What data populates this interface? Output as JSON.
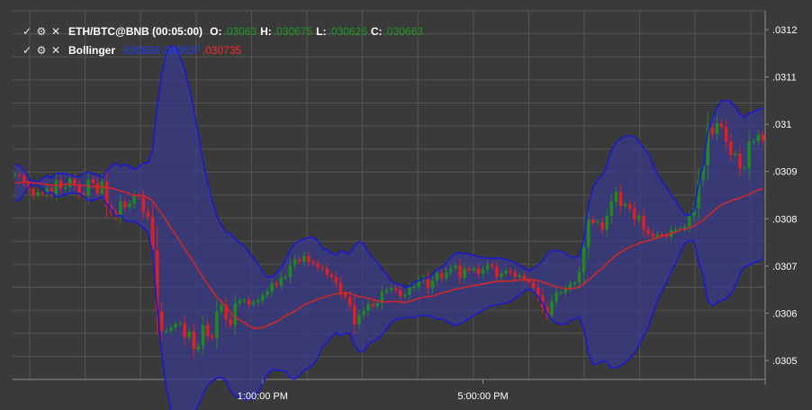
{
  "legend": {
    "symbol": "ETH/BTC@BNB (00:05:00)",
    "o_label": "O:",
    "o_value": ".03063",
    "h_label": "H:",
    "h_value": ".030675",
    "l_label": "L:",
    "l_value": ".030626",
    "c_label": "C:",
    "c_value": ".030663",
    "indicator": "Bollinger",
    "bb_upper": ".030838",
    "bb_lower": ".030637",
    "bb_middle": ".030735"
  },
  "icons": [
    "check-icon",
    "gear-icon",
    "close-icon"
  ],
  "colors": {
    "background": "#3a3a3a",
    "grid": "#555555",
    "up_candle": "#1f8a1f",
    "down_candle": "#e02020",
    "bollinger_band": "#1a1ad0",
    "bollinger_fill": "#3a3a8a",
    "bollinger_middle": "#d02828"
  },
  "chart_data": {
    "type": "candlestick",
    "ylim": [
      0.03046,
      0.03124
    ],
    "y_ticks": [
      ".0312",
      ".0311",
      ".031",
      ".0309",
      ".0308",
      ".0307",
      ".0306",
      ".0305"
    ],
    "y_tick_values": [
      0.0312,
      0.0311,
      0.031,
      0.0309,
      0.0308,
      0.0307,
      0.0306,
      0.0305
    ],
    "x_ticks": [
      {
        "label": "1:00:00 PM",
        "index": 54
      },
      {
        "label": "5:00:00 PM",
        "index": 102
      }
    ],
    "close": [
      0.030893,
      0.030891,
      0.030876,
      0.030864,
      0.03085,
      0.030856,
      0.030853,
      0.030865,
      0.030853,
      0.030881,
      0.030864,
      0.030867,
      0.030885,
      0.030871,
      0.030853,
      0.030849,
      0.030883,
      0.030875,
      0.030853,
      0.030879,
      0.030826,
      0.030814,
      0.030805,
      0.030836,
      0.030824,
      0.030832,
      0.030849,
      0.030846,
      0.030815,
      0.030804,
      0.030734,
      0.030604,
      0.030563,
      0.030563,
      0.03057,
      0.030578,
      0.030579,
      0.030549,
      0.030561,
      0.030523,
      0.030531,
      0.030575,
      0.030552,
      0.030548,
      0.030604,
      0.030618,
      0.030587,
      0.030575,
      0.030621,
      0.030627,
      0.030628,
      0.030619,
      0.030623,
      0.030628,
      0.030638,
      0.030646,
      0.030663,
      0.030659,
      0.030675,
      0.030676,
      0.030702,
      0.030714,
      0.030709,
      0.030721,
      0.030708,
      0.030706,
      0.030697,
      0.030695,
      0.030682,
      0.030677,
      0.030664,
      0.030642,
      0.030635,
      0.030617,
      0.030576,
      0.030596,
      0.030605,
      0.03062,
      0.030615,
      0.030621,
      0.030645,
      0.030649,
      0.030653,
      0.030649,
      0.030636,
      0.030639,
      0.030654,
      0.030656,
      0.03067,
      0.030675,
      0.030653,
      0.030669,
      0.030685,
      0.030674,
      0.030687,
      0.030695,
      0.030701,
      0.030675,
      0.030695,
      0.030691,
      0.030695,
      0.030683,
      0.030692,
      0.030702,
      0.030698,
      0.030677,
      0.030684,
      0.03069,
      0.030686,
      0.030676,
      0.03068,
      0.030671,
      0.030666,
      0.030654,
      0.030637,
      0.030612,
      0.030596,
      0.030625,
      0.030644,
      0.030644,
      0.030653,
      0.030662,
      0.030665,
      0.030687,
      0.03074,
      0.030798,
      0.030791,
      0.030793,
      0.030777,
      0.030806,
      0.030836,
      0.030857,
      0.030827,
      0.030831,
      0.030822,
      0.030798,
      0.030806,
      0.030777,
      0.030768,
      0.030762,
      0.030767,
      0.030765,
      0.030762,
      0.030776,
      0.030777,
      0.030778,
      0.030784,
      0.030805,
      0.030823,
      0.030883,
      0.030913,
      0.030992,
      0.030979,
      0.031002,
      0.030994,
      0.030964,
      0.030935,
      0.030938,
      0.030906,
      0.030907,
      0.030962,
      0.030964,
      0.030978,
      0.030966
    ],
    "bollinger": {
      "upper": [
        0.030915,
        0.030912,
        0.030903,
        0.030887,
        0.030868,
        0.030878,
        0.030885,
        0.030891,
        0.030886,
        0.030896,
        0.030896,
        0.030895,
        0.030893,
        0.030889,
        0.030889,
        0.030896,
        0.030899,
        0.030895,
        0.030893,
        0.030887,
        0.030901,
        0.030911,
        0.030918,
        0.030911,
        0.030915,
        0.030911,
        0.030905,
        0.03091,
        0.030918,
        0.030919,
        0.030945,
        0.031036,
        0.031106,
        0.03115,
        0.031165,
        0.031162,
        0.031142,
        0.031114,
        0.031075,
        0.031028,
        0.030977,
        0.030922,
        0.030876,
        0.030839,
        0.030806,
        0.030786,
        0.030771,
        0.030768,
        0.030758,
        0.030748,
        0.030743,
        0.030728,
        0.030717,
        0.030704,
        0.030688,
        0.030677,
        0.030676,
        0.030685,
        0.030697,
        0.030713,
        0.030734,
        0.030747,
        0.030753,
        0.030757,
        0.03076,
        0.030761,
        0.030754,
        0.030737,
        0.030734,
        0.030728,
        0.030723,
        0.030732,
        0.030728,
        0.030726,
        0.030743,
        0.030751,
        0.030747,
        0.030729,
        0.030717,
        0.030707,
        0.030693,
        0.030682,
        0.030669,
        0.030662,
        0.030661,
        0.030655,
        0.030658,
        0.030666,
        0.030669,
        0.030673,
        0.030675,
        0.030682,
        0.030693,
        0.030697,
        0.030706,
        0.030718,
        0.030727,
        0.030728,
        0.030727,
        0.030725,
        0.030723,
        0.030719,
        0.030718,
        0.030717,
        0.030716,
        0.030717,
        0.030716,
        0.030714,
        0.030711,
        0.030707,
        0.030701,
        0.030695,
        0.030691,
        0.030695,
        0.030702,
        0.030711,
        0.030725,
        0.030733,
        0.030733,
        0.030731,
        0.030727,
        0.030719,
        0.030718,
        0.03072,
        0.030757,
        0.030827,
        0.030866,
        0.030883,
        0.030891,
        0.030913,
        0.030944,
        0.030961,
        0.030969,
        0.030974,
        0.030976,
        0.030973,
        0.030965,
        0.030949,
        0.030939,
        0.030916,
        0.030894,
        0.030879,
        0.030867,
        0.03085,
        0.030839,
        0.030822,
        0.030808,
        0.030808,
        0.030818,
        0.030874,
        0.030914,
        0.030985,
        0.031013,
        0.031035,
        0.031049,
        0.031051,
        0.031047,
        0.031037,
        0.031021,
        0.031014,
        0.031023,
        0.031026,
        0.031032,
        0.031034
      ],
      "middle": [
        0.030876,
        0.030876,
        0.030878,
        0.030877,
        0.030876,
        0.030875,
        0.030874,
        0.030872,
        0.030871,
        0.030871,
        0.030872,
        0.030873,
        0.030873,
        0.030872,
        0.030871,
        0.030871,
        0.030869,
        0.030867,
        0.030868,
        0.030867,
        0.030866,
        0.030865,
        0.030862,
        0.030859,
        0.030856,
        0.030852,
        0.03085,
        0.030849,
        0.030849,
        0.030845,
        0.030837,
        0.030824,
        0.030811,
        0.030796,
        0.03078,
        0.030767,
        0.030752,
        0.030736,
        0.030722,
        0.030707,
        0.030691,
        0.030676,
        0.030662,
        0.030648,
        0.030634,
        0.030625,
        0.030614,
        0.030602,
        0.030591,
        0.030586,
        0.03058,
        0.030574,
        0.030568,
        0.030569,
        0.03057,
        0.030574,
        0.030578,
        0.030582,
        0.030588,
        0.030595,
        0.030599,
        0.030604,
        0.030611,
        0.030618,
        0.030622,
        0.030626,
        0.03063,
        0.030633,
        0.030636,
        0.030639,
        0.030641,
        0.030642,
        0.030643,
        0.030642,
        0.030638,
        0.030635,
        0.030634,
        0.030632,
        0.030629,
        0.030626,
        0.030624,
        0.030624,
        0.030625,
        0.030625,
        0.030624,
        0.030623,
        0.030625,
        0.030628,
        0.030632,
        0.030634,
        0.030635,
        0.030637,
        0.03064,
        0.030643,
        0.030645,
        0.030648,
        0.030651,
        0.030653,
        0.030655,
        0.030657,
        0.030659,
        0.03066,
        0.030662,
        0.030664,
        0.030666,
        0.030667,
        0.030668,
        0.030668,
        0.030668,
        0.030669,
        0.03067,
        0.030671,
        0.030671,
        0.03067,
        0.030669,
        0.030666,
        0.030662,
        0.030659,
        0.030656,
        0.030654,
        0.030652,
        0.030652,
        0.030653,
        0.030656,
        0.030662,
        0.030671,
        0.030679,
        0.030688,
        0.030695,
        0.030705,
        0.030714,
        0.030723,
        0.030729,
        0.030735,
        0.03074,
        0.030744,
        0.030748,
        0.030751,
        0.030754,
        0.030757,
        0.03076,
        0.030763,
        0.030766,
        0.030769,
        0.030772,
        0.030776,
        0.030778,
        0.030781,
        0.030785,
        0.030791,
        0.030797,
        0.030806,
        0.030814,
        0.030823,
        0.030829,
        0.030834,
        0.030838,
        0.030841,
        0.030844,
        0.030848,
        0.030852,
        0.030856,
        0.030861,
        0.030864
      ],
      "lower": [
        0.030838,
        0.03084,
        0.030853,
        0.030867,
        0.030883,
        0.030873,
        0.030863,
        0.030853,
        0.030856,
        0.030846,
        0.030848,
        0.030851,
        0.030854,
        0.030855,
        0.030853,
        0.030847,
        0.030839,
        0.030839,
        0.030843,
        0.030847,
        0.030831,
        0.030819,
        0.030806,
        0.030807,
        0.030797,
        0.030793,
        0.030795,
        0.030788,
        0.03078,
        0.030771,
        0.030729,
        0.030612,
        0.030516,
        0.030442,
        0.030395,
        0.030372,
        0.030362,
        0.030358,
        0.030369,
        0.030386,
        0.030405,
        0.03043,
        0.030448,
        0.030457,
        0.030462,
        0.030464,
        0.030457,
        0.030436,
        0.030424,
        0.030424,
        0.030417,
        0.030419,
        0.030419,
        0.030434,
        0.030452,
        0.030471,
        0.03048,
        0.03048,
        0.030479,
        0.030477,
        0.030464,
        0.030461,
        0.030469,
        0.030479,
        0.030484,
        0.030491,
        0.030506,
        0.030529,
        0.030538,
        0.03055,
        0.030559,
        0.030552,
        0.030558,
        0.030558,
        0.030533,
        0.030519,
        0.03052,
        0.030535,
        0.030541,
        0.030545,
        0.030555,
        0.030566,
        0.030581,
        0.030588,
        0.030587,
        0.030591,
        0.030592,
        0.03059,
        0.030595,
        0.030595,
        0.030595,
        0.030592,
        0.030587,
        0.030589,
        0.030584,
        0.030578,
        0.030575,
        0.030578,
        0.030583,
        0.030589,
        0.030595,
        0.030601,
        0.030606,
        0.030611,
        0.030616,
        0.030617,
        0.03062,
        0.030622,
        0.030625,
        0.030631,
        0.030639,
        0.030647,
        0.030651,
        0.030645,
        0.030636,
        0.030621,
        0.030599,
        0.030585,
        0.030579,
        0.030577,
        0.030577,
        0.030585,
        0.030588,
        0.030592,
        0.030567,
        0.030515,
        0.030492,
        0.030493,
        0.030499,
        0.030497,
        0.030484,
        0.030485,
        0.030489,
        0.030496,
        0.030504,
        0.030515,
        0.030531,
        0.030553,
        0.030569,
        0.030598,
        0.030626,
        0.030647,
        0.030665,
        0.030688,
        0.030706,
        0.030729,
        0.030748,
        0.030754,
        0.030752,
        0.030708,
        0.030681,
        0.030626,
        0.030616,
        0.030623,
        0.030627,
        0.030631,
        0.03064,
        0.030659,
        0.030683,
        0.030699,
        0.030701,
        0.030707,
        0.030711,
        0.030716
      ]
    }
  }
}
